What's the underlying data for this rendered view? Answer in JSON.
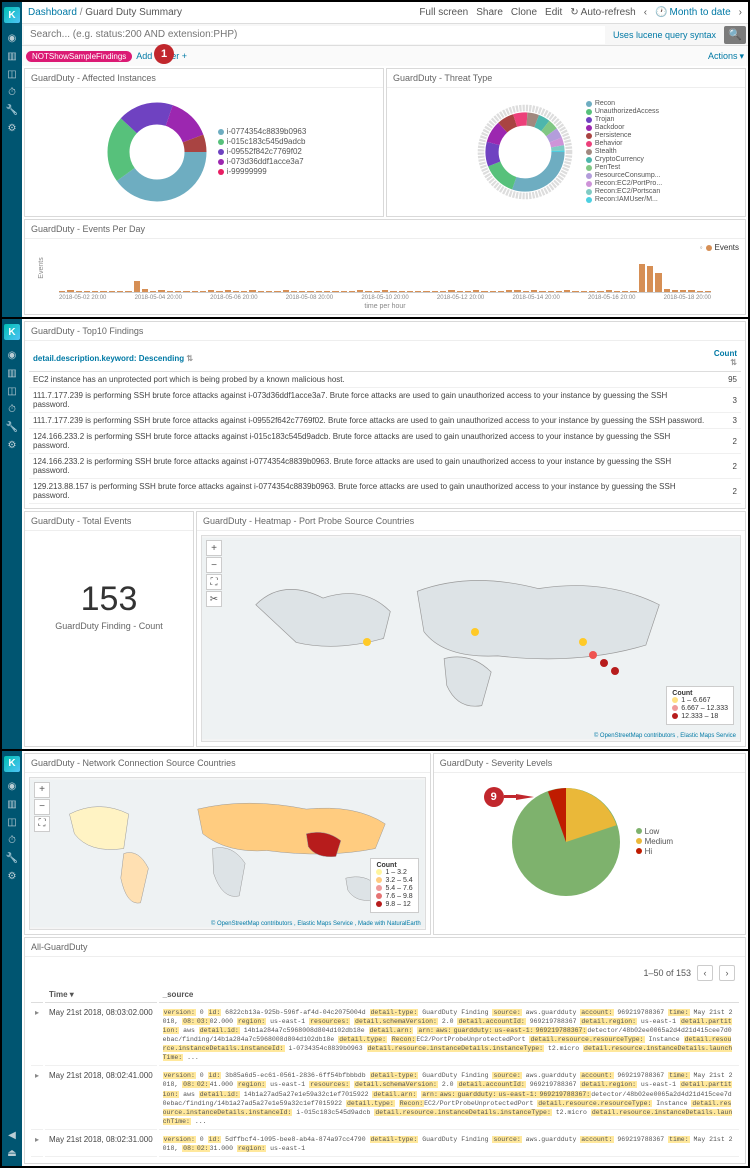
{
  "breadcrumb": {
    "root": "Dashboard",
    "current": "Guard Duty Summary"
  },
  "topbar": {
    "full_screen": "Full screen",
    "share": "Share",
    "clone": "Clone",
    "edit": "Edit",
    "auto_refresh": "Auto-refresh",
    "time_range": "Month to date"
  },
  "search": {
    "placeholder": "Search... (e.g. status:200 AND extension:PHP)",
    "lucene_link": "Uses lucene query syntax"
  },
  "filterbar": {
    "pill": "NOTShowSampleFindings",
    "add_filter": "Add a filter +",
    "actions": "Actions"
  },
  "panels": {
    "affected_instances": {
      "title": "GuardDuty - Affected Instances",
      "legend": [
        {
          "label": "i-0774354c8839b0963",
          "color": "#6eadc1"
        },
        {
          "label": "i-015c183c545d9adcb",
          "color": "#57c17b"
        },
        {
          "label": "i-09552f842c7769f02",
          "color": "#6f42c1"
        },
        {
          "label": "i-073d36ddf1acce3a7",
          "color": "#9c27b0"
        },
        {
          "label": "i-99999999",
          "color": "#e91e63"
        }
      ]
    },
    "threat_type": {
      "title": "GuardDuty - Threat Type",
      "legend": [
        {
          "label": "Recon",
          "color": "#6eadc1"
        },
        {
          "label": "UnauthorizedAccess",
          "color": "#57c17b"
        },
        {
          "label": "Trojan",
          "color": "#6f42c1"
        },
        {
          "label": "Backdoor",
          "color": "#9c27b0"
        },
        {
          "label": "Persistence",
          "color": "#a94442"
        },
        {
          "label": "Behavior",
          "color": "#ec407a"
        },
        {
          "label": "Stealth",
          "color": "#a1887f"
        },
        {
          "label": "CryptoCurrency",
          "color": "#4db6ac"
        },
        {
          "label": "PenTest",
          "color": "#81c784"
        },
        {
          "label": "ResourceConsump...",
          "color": "#b39ddb"
        },
        {
          "label": "Recon:EC2/PortPro...",
          "color": "#ce93d8"
        },
        {
          "label": "Recon:EC2/Portscan",
          "color": "#80cbc4"
        },
        {
          "label": "Recon:IAMUser/M...",
          "color": "#4dd0e1"
        }
      ]
    },
    "events_per_day": {
      "title": "GuardDuty - Events Per Day",
      "y_label": "Events",
      "x_label": "time per hour",
      "legend_label": "Events",
      "x_ticks": [
        "2018-05-02 20:00",
        "2018-05-04 20:00",
        "2018-05-06 20:00",
        "2018-05-08 20:00",
        "2018-05-10 20:00",
        "2018-05-12 20:00",
        "2018-05-14 20:00",
        "2018-05-16 20:00",
        "2018-05-18 20:00"
      ]
    },
    "top10": {
      "title": "GuardDuty - Top10 Findings",
      "col_desc": "detail.description.keyword: Descending",
      "col_count": "Count",
      "rows": [
        {
          "desc": "EC2 instance has an unprotected port which is being probed by a known malicious host.",
          "count": "95"
        },
        {
          "desc": "111.7.177.239 is performing SSH brute force attacks against i-073d36ddf1acce3a7. Brute force attacks are used to gain unauthorized access to your instance by guessing the SSH password.",
          "count": "3"
        },
        {
          "desc": "111.7.177.239 is performing SSH brute force attacks against i-09552f642c7769f02. Brute force attacks are used to gain unauthorized access to your instance by guessing the SSH password.",
          "count": "3"
        },
        {
          "desc": "124.166.233.2 is performing SSH brute force attacks against i-015c183c545d9adcb. Brute force attacks are used to gain unauthorized access to your instance by guessing the SSH password.",
          "count": "2"
        },
        {
          "desc": "124.166.233.2 is performing SSH brute force attacks against i-0774354c8839b0963. Brute force attacks are used to gain unauthorized access to your instance by guessing the SSH password.",
          "count": "2"
        },
        {
          "desc": "129.213.88.157 is performing SSH brute force attacks against i-0774354c8839b0963. Brute force attacks are used to gain unauthorized access to your instance by guessing the SSH password.",
          "count": "2"
        }
      ]
    },
    "total_events": {
      "title": "GuardDuty - Total Events",
      "value": "153",
      "label": "GuardDuty Finding - Count"
    },
    "heatmap": {
      "title": "GuardDuty - Heatmap - Port Probe Source Countries",
      "attribution": "© OpenStreetMap contributors , Elastic Maps Service",
      "legend_title": "Count",
      "legend_rows": [
        {
          "label": "1 – 6.667",
          "color": "#ffe082"
        },
        {
          "label": "6.667 – 12.333",
          "color": "#ef9a9a"
        },
        {
          "label": "12.333 – 18",
          "color": "#b71c1c"
        }
      ]
    },
    "network_countries": {
      "title": "GuardDuty - Network Connection Source Countries",
      "attribution": "© OpenStreetMap contributors , Elastic Maps Service , Made with NaturalEarth",
      "legend_title": "Count",
      "legend_rows": [
        {
          "label": "1 – 3.2",
          "color": "#fff59d"
        },
        {
          "label": "3.2 – 5.4",
          "color": "#ffcc80"
        },
        {
          "label": "5.4 – 7.6",
          "color": "#ef9a9a"
        },
        {
          "label": "7.6 – 9.8",
          "color": "#e57373"
        },
        {
          "label": "9.8 – 12",
          "color": "#b71c1c"
        }
      ]
    },
    "severity": {
      "title": "GuardDuty - Severity Levels",
      "legend": [
        {
          "label": "Low",
          "color": "#7eb26d"
        },
        {
          "label": "Medium",
          "color": "#eab839"
        },
        {
          "label": "Hi",
          "color": "#bf1b00"
        }
      ]
    },
    "all_guardduty": {
      "title": "All-GuardDuty",
      "pager_text": "1–50 of 153",
      "col_time": "Time",
      "col_source": "_source",
      "rows": [
        {
          "time": "May 21st 2018, 08:03:02.000",
          "source": "version: 0 id: 6822cb13a-925b-596f-af4d-04c2075004d detail-type: GuardDuty Finding source: aws.guardduty account: 969219788367 time: May 21st 2018, 08:03:02.000 region: us-east-1 resources: detail.schemaVersion: 2.0 detail.accountId: 969219788367 detail.region: us-east-1 detail.partition: aws detail.id: 14b1a284a7c5968008d804d102db18e detail.arn: arn:aws:guardduty:us-east-1:969219788367:detector/48b02ee0065a2d4d21d415cee7d0ebac/finding/14b1a284a7c5968008d804d102db18e detail.type: Recon:EC2/PortProbeUnprotectedPort detail.resource.resourceType: Instance detail.resource.instanceDetails.instanceId: i-0734354c8839b0963 detail.resource.instanceDetails.instanceType: t2.micro detail.resource.instanceDetails.launchTime: ..."
        },
        {
          "time": "May 21st 2018, 08:02:41.000",
          "source": "version: 0 id: 3b85a6d5-ec61-0561-2836-6ff54bfbbbdb detail-type: GuardDuty Finding source: aws.guardduty account: 969219788367 time: May 21st 2018, 08:02:41.000 region: us-east-1 resources: detail.schemaVersion: 2.0 detail.accountId: 969219788367 detail.region: us-east-1 detail.partition: aws detail.id: 14b1a27ad5a27e1e59a32c1ef7015922 detail.arn: arn:aws:guardduty:us-east-1:969219788367:detector/48b02ee0065a2d4d21d415cee7d0ebac/finding/14b1a27ad5a27e1e59a32c1ef7015922 detail.type: Recon:EC2/PortProbeUnprotectedPort detail.resource.resourceType: Instance detail.resource.instanceDetails.instanceId: i-015c183c545d9adcb detail.resource.instanceDetails.instanceType: t2.micro detail.resource.instanceDetails.launchTime: ..."
        },
        {
          "time": "May 21st 2018, 08:02:31.000",
          "source": "version: 0 id: 5dffbcf4-1095-bee8-ab4a-874a97cc4790 detail-type: GuardDuty Finding source: aws.guardduty account: 969219788367 time: May 21st 2018, 08:02:31.000 region: us-east-1"
        }
      ]
    }
  },
  "chart_data": [
    {
      "type": "pie",
      "panel": "affected_instances",
      "donut": true,
      "series": [
        {
          "name": "i-0774354c8839b0963",
          "value": 40
        },
        {
          "name": "i-015c183c545d9adcb",
          "value": 22
        },
        {
          "name": "i-09552f842c7769f02",
          "value": 18
        },
        {
          "name": "i-073d36ddf1acce3a7",
          "value": 14
        },
        {
          "name": "i-99999999",
          "value": 6
        }
      ]
    },
    {
      "type": "pie",
      "panel": "threat_type",
      "donut": true,
      "series": [
        {
          "name": "Recon",
          "value": 30
        },
        {
          "name": "UnauthorizedAccess",
          "value": 14
        },
        {
          "name": "Trojan",
          "value": 10
        },
        {
          "name": "Backdoor",
          "value": 9
        },
        {
          "name": "Persistence",
          "value": 7
        },
        {
          "name": "Behavior",
          "value": 6
        },
        {
          "name": "Stealth",
          "value": 5
        },
        {
          "name": "CryptoCurrency",
          "value": 5
        },
        {
          "name": "PenTest",
          "value": 4
        },
        {
          "name": "ResourceConsumption",
          "value": 4
        },
        {
          "name": "Recon:EC2/PortProbe",
          "value": 3
        },
        {
          "name": "Recon:EC2/Portscan",
          "value": 2
        },
        {
          "name": "Recon:IAMUser",
          "value": 1
        }
      ]
    },
    {
      "type": "bar",
      "panel": "events_per_day",
      "xlabel": "time per hour",
      "ylabel": "Events",
      "categories": [
        "2018-05-02 20:00",
        "2018-05-04 20:00",
        "2018-05-06 20:00",
        "2018-05-08 20:00",
        "2018-05-10 20:00",
        "2018-05-12 20:00",
        "2018-05-14 20:00",
        "2018-05-16 20:00",
        "2018-05-18 20:00"
      ],
      "values": [
        3,
        4,
        3,
        2,
        2,
        3,
        3,
        2,
        3,
        24,
        6,
        3,
        4,
        3,
        3,
        2,
        3,
        3,
        5,
        3,
        4,
        3,
        3,
        4,
        2,
        3,
        2,
        4,
        3,
        2,
        3,
        2,
        3,
        3,
        2,
        3,
        4,
        3,
        3,
        4,
        3,
        2,
        3,
        3,
        3,
        3,
        2,
        4,
        3,
        2,
        4,
        3,
        3,
        2,
        5,
        4,
        3,
        4,
        3,
        2,
        3,
        4,
        3,
        2,
        3,
        2,
        4,
        3,
        3,
        3,
        60,
        55,
        40,
        6,
        5,
        4,
        4,
        3,
        3
      ]
    },
    {
      "type": "pie",
      "panel": "severity",
      "series": [
        {
          "name": "Low",
          "value": 78
        },
        {
          "name": "Medium",
          "value": 17
        },
        {
          "name": "Hi",
          "value": 5
        }
      ]
    }
  ]
}
